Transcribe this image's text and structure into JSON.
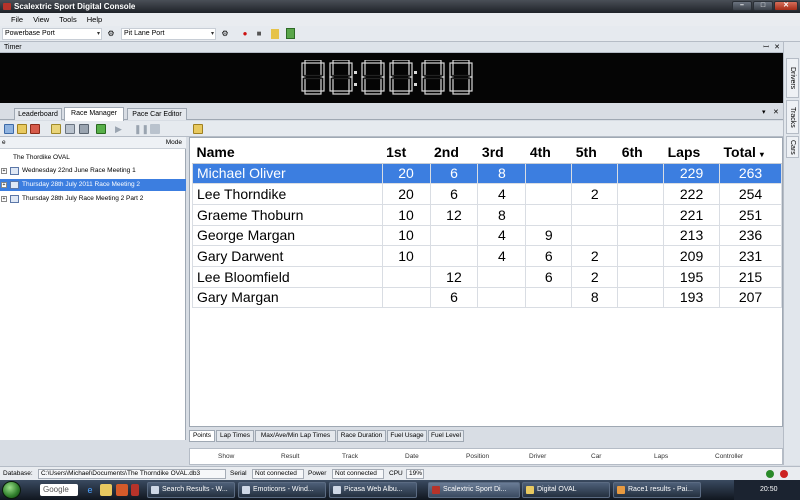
{
  "window": {
    "title": "Scalextric Sport Digital Console",
    "min": "–",
    "max": "□",
    "close": "✕"
  },
  "menu": [
    "File",
    "View",
    "Tools",
    "Help"
  ],
  "toolbar1": {
    "powerbase_port": "Powerbase Port",
    "pitlane_port": "Pit Lane Port",
    "caret": "▾",
    "record_glyph": "●",
    "stop_glyph": "■"
  },
  "timer": {
    "header": "Timer",
    "pin": "ꟷ",
    "close": "✕",
    "display": "00:00:00",
    "digits": [
      "0",
      "0",
      "0",
      "0",
      "0",
      "0"
    ]
  },
  "right_tabs": [
    "Drivers",
    "Tracks",
    "Cars"
  ],
  "tabs": [
    {
      "label": "Leaderboard",
      "active": false
    },
    {
      "label": "Race Manager",
      "active": true
    },
    {
      "label": "Pace Car Editor",
      "active": false
    }
  ],
  "tabs_controls": {
    "dropdown": "▾",
    "close": "✕"
  },
  "tree": {
    "header_left": "e",
    "header_right": "Mode",
    "items": [
      {
        "label": "The Thordike OVAL",
        "expander": "",
        "selected": false
      },
      {
        "label": "Wednesday 22nd June Race Meeting 1",
        "expander": "+",
        "selected": false
      },
      {
        "label": "Thursday 28th July 2011 Race Meeting 2",
        "expander": "+",
        "selected": true
      },
      {
        "label": "Thursday 28th July Race Meeting 2 Part 2",
        "expander": "+",
        "selected": false
      }
    ]
  },
  "results": {
    "columns": [
      "Name",
      "1st",
      "2nd",
      "3rd",
      "4th",
      "5th",
      "6th",
      "Laps",
      "Total"
    ],
    "sort_glyph": "▾",
    "rows": [
      {
        "cells": [
          "Michael Oliver",
          "20",
          "6",
          "8",
          "",
          "",
          "",
          "229",
          "263"
        ],
        "selected": true
      },
      {
        "cells": [
          "Lee Thorndike",
          "20",
          "6",
          "4",
          "",
          "2",
          "",
          "222",
          "254"
        ],
        "selected": false
      },
      {
        "cells": [
          "Graeme Thoburn",
          "10",
          "12",
          "8",
          "",
          "",
          "",
          "221",
          "251"
        ],
        "selected": false
      },
      {
        "cells": [
          "George Margan",
          "10",
          "",
          "4",
          "9",
          "",
          "",
          "213",
          "236"
        ],
        "selected": false
      },
      {
        "cells": [
          "Gary Darwent",
          "10",
          "",
          "4",
          "6",
          "2",
          "",
          "209",
          "231"
        ],
        "selected": false
      },
      {
        "cells": [
          "Lee Bloomfield",
          "",
          "12",
          "",
          "6",
          "2",
          "",
          "195",
          "215"
        ],
        "selected": false
      },
      {
        "cells": [
          "Gary Margan",
          "",
          "6",
          "",
          "",
          "8",
          "",
          "193",
          "207"
        ],
        "selected": false
      }
    ]
  },
  "bottom_tabs": [
    {
      "label": "Points",
      "active": true
    },
    {
      "label": "Lap Times",
      "active": false
    },
    {
      "label": "Max/Ave/Min Lap Times",
      "active": false
    },
    {
      "label": "Race Duration",
      "active": false
    },
    {
      "label": "Fuel Usage",
      "active": false
    },
    {
      "label": "Fuel Level",
      "active": false
    }
  ],
  "lower_headers": [
    "Show",
    "Result",
    "Track",
    "Date",
    "Position",
    "Driver",
    "Car",
    "Laps",
    "Controller"
  ],
  "status": {
    "database_label": "Database:",
    "database_path": "C:\\Users\\Michael\\Documents\\The Thorndike OVAL.db3",
    "serial_label": "Serial",
    "serial_value": "Not connected",
    "power_label": "Power",
    "power_value": "Not connected",
    "cpu_label": "CPU",
    "cpu_value": "19%",
    "dot_colors": [
      "#2a8a2a",
      "#cc2222"
    ]
  },
  "taskbar": {
    "search": "Google",
    "tasks": [
      {
        "label": "Search Results - W...",
        "active": false
      },
      {
        "label": "Emoticons - Wind...",
        "active": false
      },
      {
        "label": "Picasa Web Albu...",
        "active": false
      },
      {
        "label": "Scalextric Sport Di...",
        "active": true
      },
      {
        "label": "Digital OVAL",
        "active": false
      },
      {
        "label": "Race1 results - Pai...",
        "active": false
      }
    ],
    "clock": "20:50"
  },
  "colors": {
    "selection": "#3c7ee0",
    "timer_bg": "#050505",
    "digit": "#d8d8d8"
  }
}
